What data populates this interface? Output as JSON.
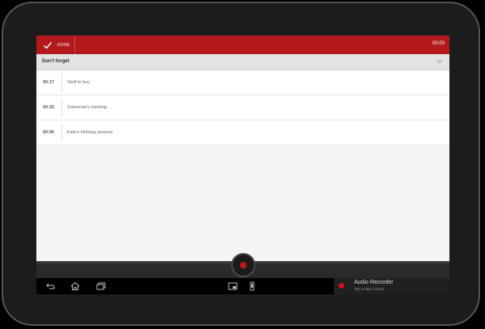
{
  "actionbar": {
    "done_label": "DONE",
    "timer": "00:03"
  },
  "section": {
    "title": "Don't forget"
  },
  "notes": [
    {
      "time": "00:17",
      "title": "Stuff to buy"
    },
    {
      "time": "00:25",
      "title": "Tomorrow's meeting"
    },
    {
      "time": "00:06",
      "title": "Kate's birthday present"
    }
  ],
  "notification": {
    "title": "Audio Recorder",
    "subtitle": "Tap to take control"
  },
  "colors": {
    "accent": "#b3191c",
    "record": "#c2181b"
  },
  "icons": {
    "done": "check-icon",
    "section": "chevron-down-icon",
    "record": "record-icon",
    "nav": [
      "back-icon",
      "home-icon",
      "recent-apps-icon",
      "screenshot-icon",
      "phone-icon"
    ]
  }
}
